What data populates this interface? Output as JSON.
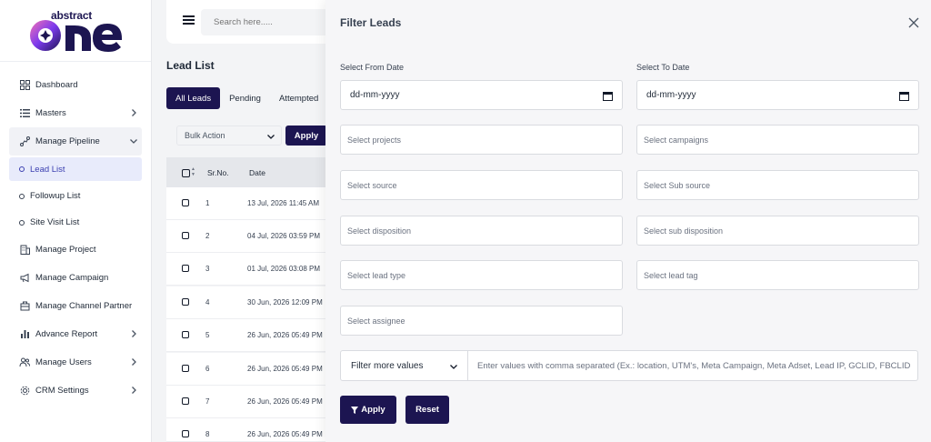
{
  "brand": {
    "top": "abstract",
    "bottom": "one",
    "colors": {
      "navy": "#1c1551",
      "purple": "#6d28d9"
    }
  },
  "sidebar": {
    "items": [
      {
        "label": "Dashboard",
        "icon": "grid-icon"
      },
      {
        "label": "Masters",
        "icon": "list-icon",
        "chevron": "right"
      },
      {
        "label": "Manage Pipeline",
        "icon": "pipeline-icon",
        "chevron": "down"
      },
      {
        "label": "Manage Project",
        "icon": "building-icon"
      },
      {
        "label": "Manage Campaign",
        "icon": "megaphone-icon"
      },
      {
        "label": "Manage Channel Partner",
        "icon": "handshake-icon"
      },
      {
        "label": "Advance Report",
        "icon": "bar-chart-icon",
        "chevron": "right"
      },
      {
        "label": "Manage Users",
        "icon": "users-icon",
        "chevron": "right"
      },
      {
        "label": "CRM Settings",
        "icon": "gear-icon",
        "chevron": "right"
      }
    ],
    "subitems": [
      {
        "label": "Lead List",
        "active": true
      },
      {
        "label": "Followup List"
      },
      {
        "label": "Site Visit List"
      }
    ]
  },
  "topbar": {
    "search_placeholder": "Search here....."
  },
  "leads": {
    "title": "Lead List",
    "tabs": [
      "All Leads",
      "Pending",
      "Attempted"
    ],
    "bulk_action": "Bulk Action",
    "apply_label": "Apply",
    "columns": [
      "Sr.No.",
      "Date"
    ],
    "rows": [
      {
        "sr": "1",
        "date": "13 Jul, 2026 11:45 AM"
      },
      {
        "sr": "2",
        "date": "04 Jul, 2026 03:59 PM"
      },
      {
        "sr": "3",
        "date": "01 Jul, 2026 03:08 PM"
      },
      {
        "sr": "4",
        "date": "30 Jun, 2026 12:09 PM"
      },
      {
        "sr": "5",
        "date": "26 Jun, 2026 05:49 PM"
      },
      {
        "sr": "6",
        "date": "26 Jun, 2026 05:49 PM"
      },
      {
        "sr": "7",
        "date": "26 Jun, 2026 05:49 PM"
      },
      {
        "sr": "8",
        "date": "26 Jun, 2026 05:49 PM"
      }
    ]
  },
  "filter": {
    "title": "Filter Leads",
    "from_label": "Select From Date",
    "to_label": "Select To Date",
    "date_placeholder": "dd-mm-yyyy",
    "fields": {
      "projects": "Select projects",
      "campaigns": "Select campaigns",
      "source": "Select source",
      "sub_source": "Select Sub source",
      "disposition": "Select disposition",
      "sub_disposition": "Select sub disposition",
      "lead_type": "Select lead type",
      "lead_tag": "Select lead tag",
      "assignee": "Select assignee"
    },
    "more_values_label": "Filter more values",
    "more_values_placeholder": "Enter values with comma separated (Ex.: location, UTM's, Meta Campaign, Meta Adset, Lead IP, GCLID, FBCLID)",
    "apply_label": "Apply",
    "reset_label": "Reset"
  }
}
